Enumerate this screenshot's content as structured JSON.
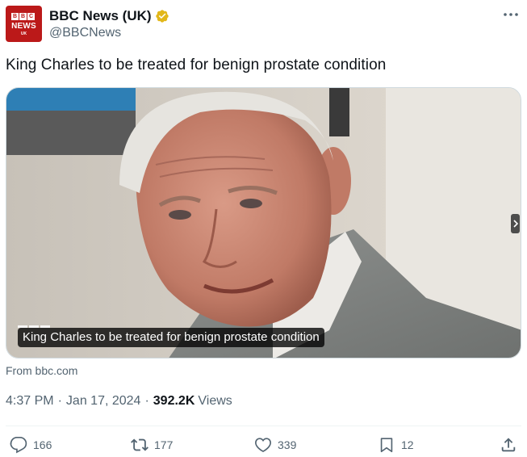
{
  "author": {
    "display_name": "BBC News (UK)",
    "handle": "@BBCNews",
    "avatar_letters": [
      "B",
      "B",
      "C"
    ],
    "avatar_word": "NEWS",
    "avatar_region": "UK",
    "verified_color": "#e2b719"
  },
  "tweet": {
    "text": "King Charles to be treated for benign prostate condition",
    "media_caption": "King Charles to be treated for benign prostate condition",
    "source": "From bbc.com"
  },
  "meta": {
    "time": "4:37 PM",
    "separator": "·",
    "date": "Jan 17, 2024",
    "views_count": "392.2K",
    "views_label": "Views"
  },
  "actions": {
    "reply_count": "166",
    "retweet_count": "177",
    "like_count": "339",
    "bookmark_count": "12"
  },
  "colors": {
    "brand_red": "#bb1919",
    "text_primary": "#0f1419",
    "text_secondary": "#536471"
  },
  "icons": [
    "more-icon",
    "verified-icon",
    "reply-icon",
    "retweet-icon",
    "like-icon",
    "bookmark-icon",
    "share-icon",
    "chevron-right-icon"
  ]
}
